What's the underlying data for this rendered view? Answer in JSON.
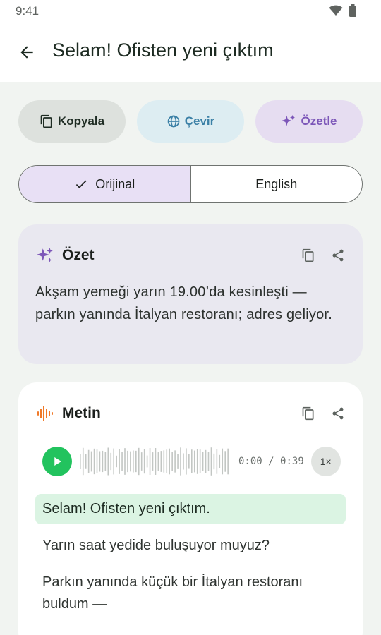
{
  "status": {
    "time": "9:41"
  },
  "appbar": {
    "title": "Selam! Ofisten yeni çıktım"
  },
  "actions": {
    "copy": "Kopyala",
    "translate": "Çevir",
    "summarize": "Özetle"
  },
  "language_toggle": {
    "original": "Orijinal",
    "english": "English",
    "selected": "Orijinal"
  },
  "summary": {
    "title": "Özet",
    "text": "Akşam yemeği yarın 19.00’da kesinleşti — parkın yanında İtalyan restoranı; adres geliyor."
  },
  "transcript": {
    "title": "Metin",
    "player": {
      "current_time": "0:00",
      "separator": "/",
      "duration": "0:39",
      "speed": "1×",
      "progress": 0
    },
    "sentences": [
      "Selam! Ofisten yeni çıktım.",
      "Yarın saat yedide buluşuyor muyuz?",
      "Parkın yanında küçük bir İtalyan restoranı buldum —"
    ]
  },
  "colors": {
    "accent_green": "#22c35e",
    "summarize_purple": "#7c56b8",
    "translate_blue": "#3b80a6",
    "audio_orange": "#f07a2a"
  }
}
